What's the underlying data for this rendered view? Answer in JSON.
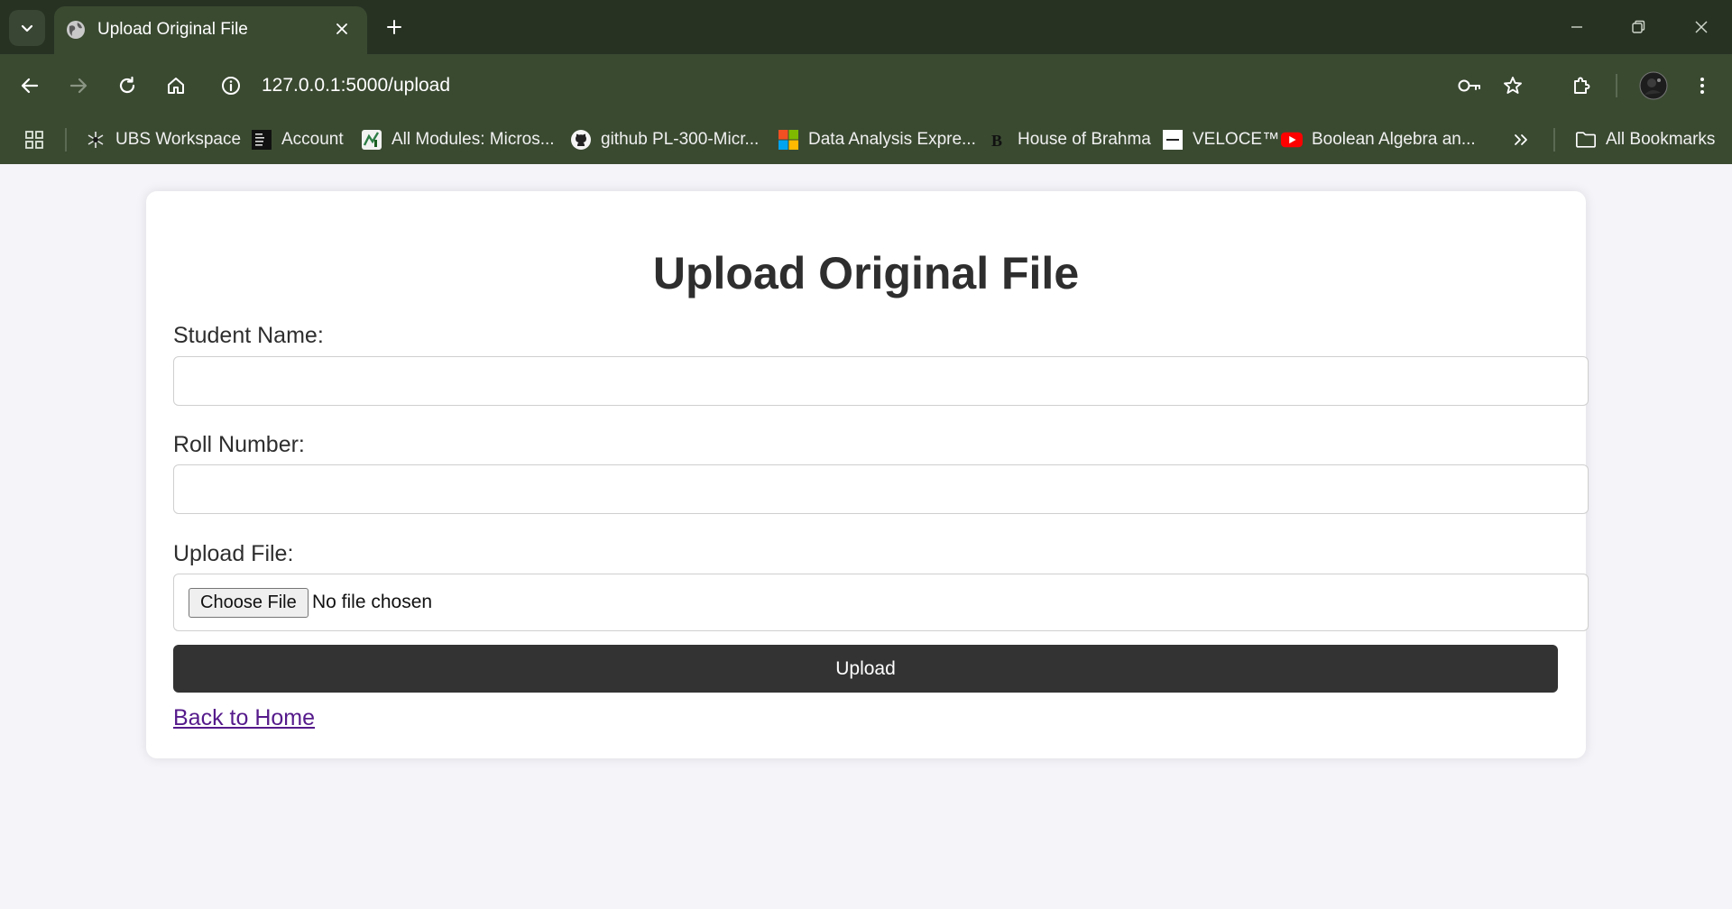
{
  "browser": {
    "tab_title": "Upload Original File",
    "url": "127.0.0.1:5000/upload",
    "bookmarks": [
      {
        "label": "UBS Workspace",
        "icon": "ubs-icon"
      },
      {
        "label": "Account",
        "icon": "house-of-bare-icon"
      },
      {
        "label": "All Modules: Micros...",
        "icon": "modules-icon"
      },
      {
        "label": "github PL-300-Micr...",
        "icon": "github-icon"
      },
      {
        "label": "Data Analysis Expre...",
        "icon": "microsoft-icon"
      },
      {
        "label": "House of Brahma",
        "icon": "brahma-icon"
      },
      {
        "label": "VELOCE™",
        "icon": "veloce-icon"
      },
      {
        "label": "Boolean Algebra an...",
        "icon": "youtube-icon"
      }
    ],
    "all_bookmarks_label": "All Bookmarks"
  },
  "page": {
    "title": "Upload Original File",
    "student_name_label": "Student Name:",
    "student_name_value": "",
    "roll_number_label": "Roll Number:",
    "roll_number_value": "",
    "upload_file_label": "Upload File:",
    "choose_file_label": "Choose File",
    "no_file_text": "No file chosen",
    "submit_label": "Upload",
    "back_link": "Back to Home"
  },
  "colors": {
    "chrome_dark": "#273223",
    "chrome": "#3a4a31",
    "page_bg": "#f4f4f9",
    "button": "#333333",
    "link": "#551a8b"
  }
}
